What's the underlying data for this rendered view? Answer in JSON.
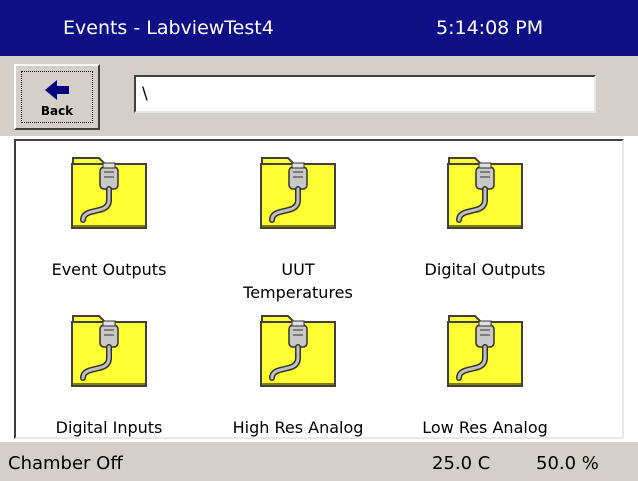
{
  "header": {
    "title": "Events - LabviewTest4",
    "time": "5:14:08 PM"
  },
  "toolbar": {
    "back_label": "Back",
    "path_value": "\\"
  },
  "folders": [
    {
      "label": "Event Outputs",
      "icon": "connector-folder-icon"
    },
    {
      "label": "UUT\nTemperatures",
      "icon": "connector-folder-icon"
    },
    {
      "label": "Digital Outputs",
      "icon": "connector-folder-icon"
    },
    {
      "label": "Digital Inputs",
      "icon": "connector-folder-icon"
    },
    {
      "label": "High Res Analog",
      "icon": "connector-folder-icon"
    },
    {
      "label": "Low Res Analog",
      "icon": "connector-folder-icon"
    }
  ],
  "status": {
    "chamber": "Chamber Off",
    "temperature": "25.0 C",
    "humidity": "50.0 %"
  },
  "colors": {
    "titlebar": "#0f0f86",
    "folder_fill": "#ffff33",
    "panel": "#d4d0c8"
  }
}
